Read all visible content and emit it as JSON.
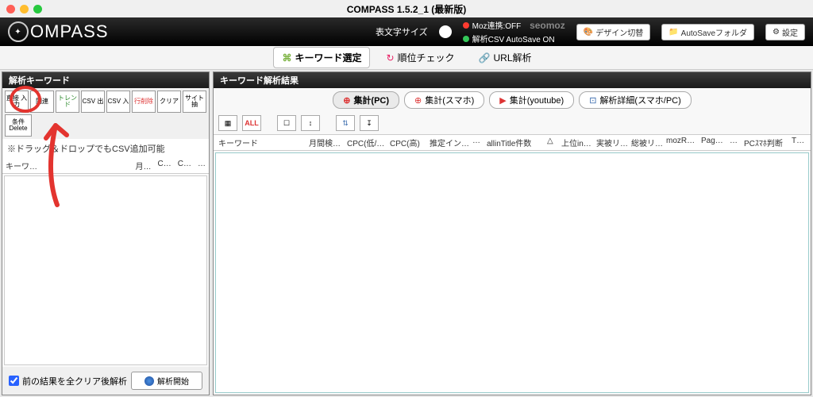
{
  "window": {
    "title": "COMPASS 1.5.2_1 (最新版)"
  },
  "header": {
    "logo": "OMPASS",
    "font_size_label": "表文字サイズ",
    "moz_status": "Moz連携:OFF",
    "seomoz": "seomoz",
    "csv_status": "解析CSV AutoSave ON",
    "btn_design": "デザイン切替",
    "btn_autosave": "AutoSaveフォルダ",
    "btn_settings": "設定"
  },
  "tabs": {
    "keyword": "キーワード選定",
    "rank": "順位チェック",
    "url": "URL解析"
  },
  "left": {
    "title": "解析キーワード",
    "buttons": [
      "直接\n入力",
      "関連",
      "トレンド",
      "CSV\n出",
      "CSV\n入",
      "行削除",
      "クリア",
      "サイト抽",
      "条件\nDelete"
    ],
    "hint": "※ドラッグ＆ドロップでもCSV追加可能",
    "cols": [
      "キーワ…",
      "月…",
      "C…",
      "C…",
      "…"
    ],
    "checkbox_label": "前の結果を全クリア後解析",
    "start": "解析開始"
  },
  "right": {
    "title": "キーワード解析結果",
    "subtabs": [
      "集計(PC)",
      "集計(スマホ)",
      "集計(youtube)",
      "解析詳細(スマホ/PC)"
    ],
    "smallbtns": [
      "▦",
      "ALL",
      "☐",
      "↕",
      "⇅",
      "↧"
    ],
    "cols": [
      "キーワード",
      "月間検…",
      "CPC(低/…",
      "CPC(高)",
      "推定イン…",
      "…",
      "allinTitle件数",
      "△",
      "上位in…",
      "実被リ…",
      "総被リ…",
      "mozR…",
      "Pag…",
      "…",
      "PCｽﾏﾎ判断",
      "T…"
    ]
  }
}
